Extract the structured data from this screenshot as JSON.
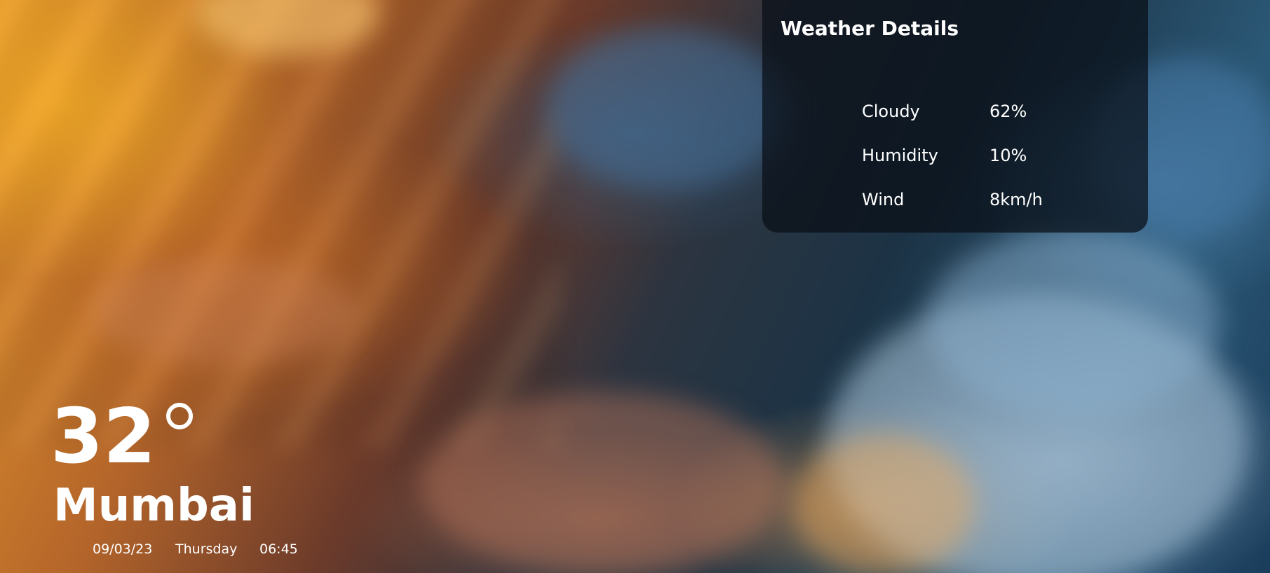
{
  "weather_details": {
    "title": "Weather Details",
    "rows": [
      {
        "label": "Cloudy",
        "value": "62%"
      },
      {
        "label": "Humidity",
        "value": "10%"
      },
      {
        "label": "Wind",
        "value": "8km/h"
      }
    ]
  },
  "current": {
    "temperature": "32",
    "degree_icon": "degree-symbol-icon",
    "city": "Mumbai",
    "date": "09/03/23",
    "day": "Thursday",
    "time": "06:45"
  }
}
